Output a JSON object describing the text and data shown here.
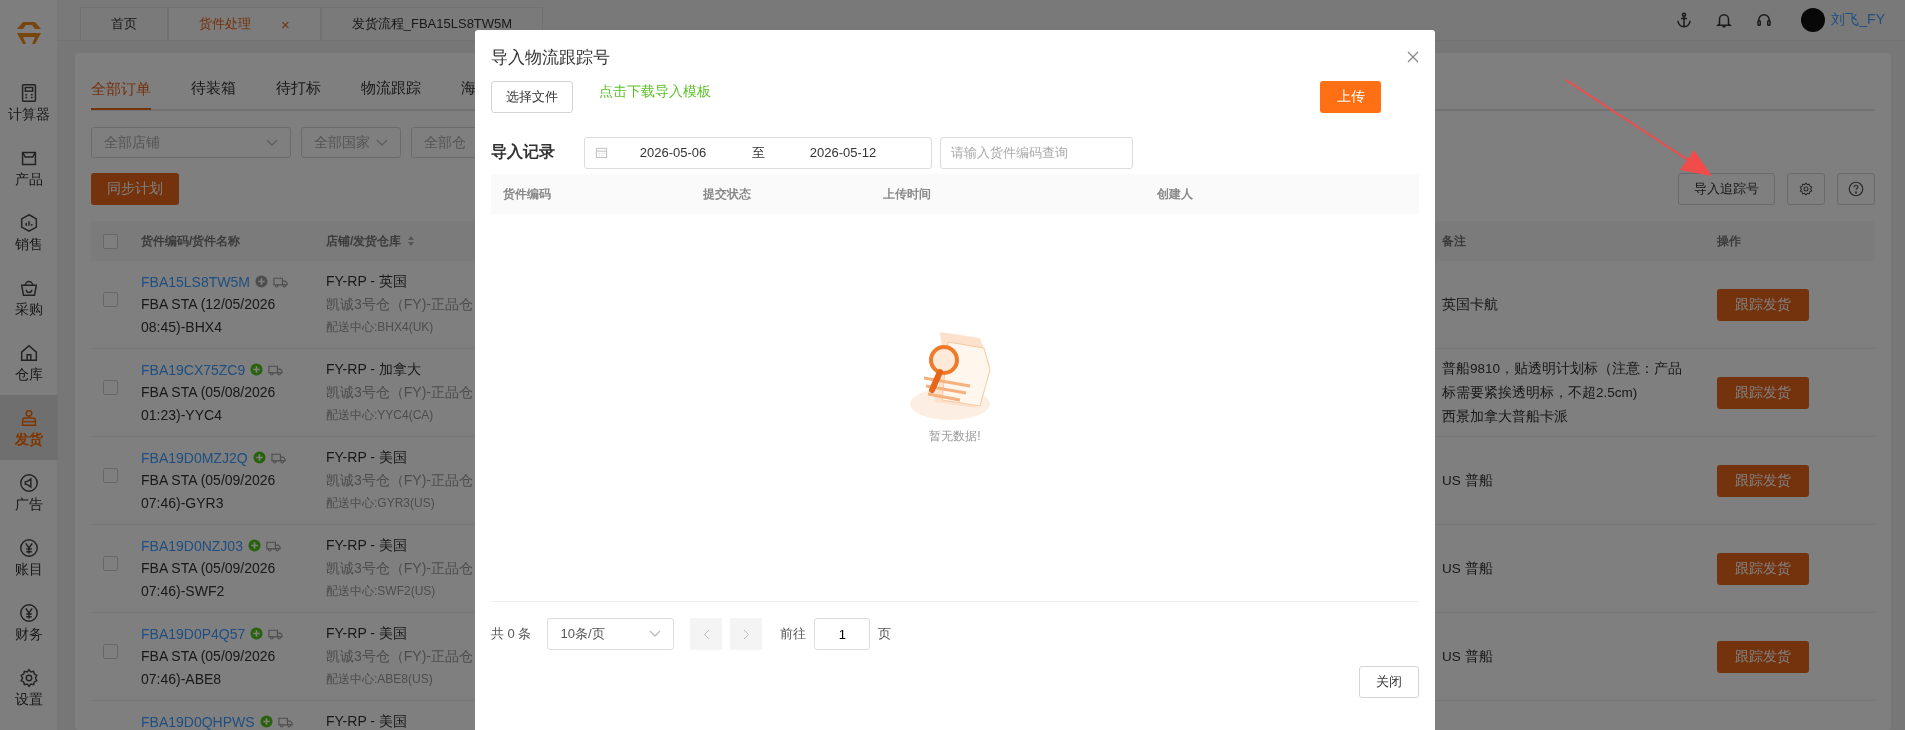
{
  "top_tabs": [
    {
      "label": "首页",
      "selected": false,
      "closable": false
    },
    {
      "label": "货件处理",
      "selected": true,
      "closable": true,
      "close": "×"
    },
    {
      "label": "发货流程_FBA15LS8TW5M",
      "selected": false,
      "closable": false
    }
  ],
  "user": {
    "name": "刘飞_FY"
  },
  "sidebar": {
    "items": [
      {
        "label": "计算器",
        "selected": false
      },
      {
        "label": "产品",
        "selected": false
      },
      {
        "label": "销售",
        "selected": false
      },
      {
        "label": "采购",
        "selected": false
      },
      {
        "label": "仓库",
        "selected": false
      },
      {
        "label": "发货",
        "selected": true
      },
      {
        "label": "广告",
        "selected": false
      },
      {
        "label": "账目",
        "selected": false
      },
      {
        "label": "财务",
        "selected": false
      },
      {
        "label": "设置",
        "selected": false
      }
    ]
  },
  "page_tabs": [
    {
      "label": "全部订单",
      "selected": true
    },
    {
      "label": "待装箱",
      "selected": false
    },
    {
      "label": "待打标",
      "selected": false
    },
    {
      "label": "物流跟踪",
      "selected": false
    },
    {
      "label": "海",
      "selected": false
    }
  ],
  "filters": [
    {
      "placeholder": "全部店铺"
    },
    {
      "placeholder": "全部国家"
    },
    {
      "placeholder": "全部仓"
    }
  ],
  "sync_button": "同步计划",
  "import_button": "导入追踪号",
  "table": {
    "select_all": {
      "checked": false
    },
    "columns": [
      {
        "label": "货件编码/货件名称",
        "sortable": false
      },
      {
        "label": "店铺/发货仓库",
        "sortable": true
      },
      {
        "label": "备注",
        "sortable": false
      },
      {
        "label": "操作",
        "sortable": false
      }
    ],
    "rows": [
      {
        "code": "FBA15LS8TW5M",
        "checked": false,
        "active": false,
        "name": "FBA STA (12/05/2026 08:45)-BHX4",
        "store": "FY-RP - 英国",
        "warehouse": "凯诚3号仓（FY)-正品仓",
        "center": "配送中心:BHX4(UK)",
        "note": "英国卡航",
        "action": "跟踪发货"
      },
      {
        "code": "FBA19CX75ZC9",
        "checked": false,
        "active": true,
        "name": "FBA STA (05/08/2026 01:23)-YYC4",
        "store": "FY-RP - 加拿大",
        "warehouse": "凯诚3号仓（FY)-正品仓",
        "center": "配送中心:YYC4(CA)",
        "note": "普船9810，贴透明计划标（注意：产品标需要紧挨透明标，不超2.5cm)\n西景加拿大普船卡派",
        "action": "跟踪发货"
      },
      {
        "code": "FBA19D0MZJ2Q",
        "checked": false,
        "active": true,
        "name": "FBA STA (05/09/2026 07:46)-GYR3",
        "store": "FY-RP - 美国",
        "warehouse": "凯诚3号仓（FY)-正品仓",
        "center": "配送中心:GYR3(US)",
        "note": "US 普船",
        "action": "跟踪发货"
      },
      {
        "code": "FBA19D0NZJ03",
        "checked": false,
        "active": true,
        "name": "FBA STA (05/09/2026 07:46)-SWF2",
        "store": "FY-RP - 美国",
        "warehouse": "凯诚3号仓（FY)-正品仓",
        "center": "配送中心:SWF2(US)",
        "note": "US 普船",
        "action": "跟踪发货"
      },
      {
        "code": "FBA19D0P4Q57",
        "checked": false,
        "active": true,
        "name": "FBA STA (05/09/2026 07:46)-ABE8",
        "store": "FY-RP - 美国",
        "warehouse": "凯诚3号仓（FY)-正品仓",
        "center": "配送中心:ABE8(US)",
        "note": "US 普船",
        "action": "跟踪发货"
      },
      {
        "code": "FBA19D0QHPWS",
        "active": true,
        "store": "FY-RP - 美国"
      }
    ]
  },
  "modal": {
    "title": "导入物流跟踪号",
    "choose_file": "选择文件",
    "template_link": "点击下载导入模板",
    "upload": "上传",
    "records_label": "导入记录",
    "date_start": "2026-05-06",
    "date_separator": "至",
    "date_end": "2026-05-12",
    "search_placeholder": "请输入货件编码查询",
    "columns": [
      "货件编码",
      "提交状态",
      "上传时间",
      "创建人"
    ],
    "empty_text": "暂无数据!",
    "pagination": {
      "total": "共 0 条",
      "page_size": "10条/页",
      "goto_label": "前往",
      "page": "1",
      "page_suffix": "页"
    },
    "close_button": "关闭"
  }
}
